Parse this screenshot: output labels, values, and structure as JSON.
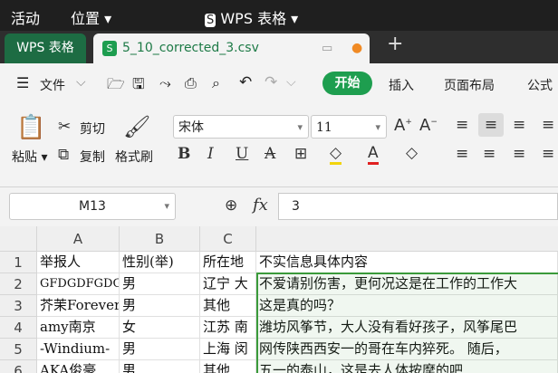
{
  "system_bar": {
    "activities": "活动",
    "location": "位置",
    "app": "WPS 表格"
  },
  "tabs": {
    "home": "WPS 表格",
    "file": "5_10_corrected_3.csv",
    "add": "+"
  },
  "menu": {
    "file": "文件",
    "start": "开始",
    "insert": "插入",
    "page_layout": "页面布局",
    "formula": "公式"
  },
  "ribbon": {
    "paste": "粘贴",
    "cut": "剪切",
    "copy": "复制",
    "format_painter": "格式刷",
    "font_name": "宋体",
    "font_size": "11"
  },
  "formula_bar": {
    "cell_ref": "M13",
    "fx": "fx",
    "value": "3"
  },
  "sheet": {
    "columns": [
      "A",
      "B",
      "C",
      ""
    ],
    "rows": [
      "1",
      "2",
      "3",
      "4",
      "5",
      "6"
    ],
    "cells": [
      [
        "举报人",
        "性别(举)",
        "所在地",
        "不实信息具体内容"
      ],
      [
        "GFDGDFGDGI",
        "男",
        "辽宁 大",
        "不爱请别伤害，更何况这是在工作的工作大"
      ],
      [
        "芥茉Forever",
        "男",
        "其他",
        "这是真的吗？"
      ],
      [
        "amy南京",
        "女",
        "江苏 南",
        "潍坊风筝节，大人没有看好孩子，风筝尾巴"
      ],
      [
        "-Windium-",
        "男",
        "上海 闵",
        "网传陕西西安一的哥在车内猝死。 随后，"
      ],
      [
        "AKA俊豪",
        "男",
        "其他",
        "五一的泰山，这是去人体按摩的吧"
      ]
    ]
  },
  "colors": {
    "accent": "#1d6c43",
    "start_button": "#1e9e4f",
    "selection": "#3a9a3a"
  }
}
